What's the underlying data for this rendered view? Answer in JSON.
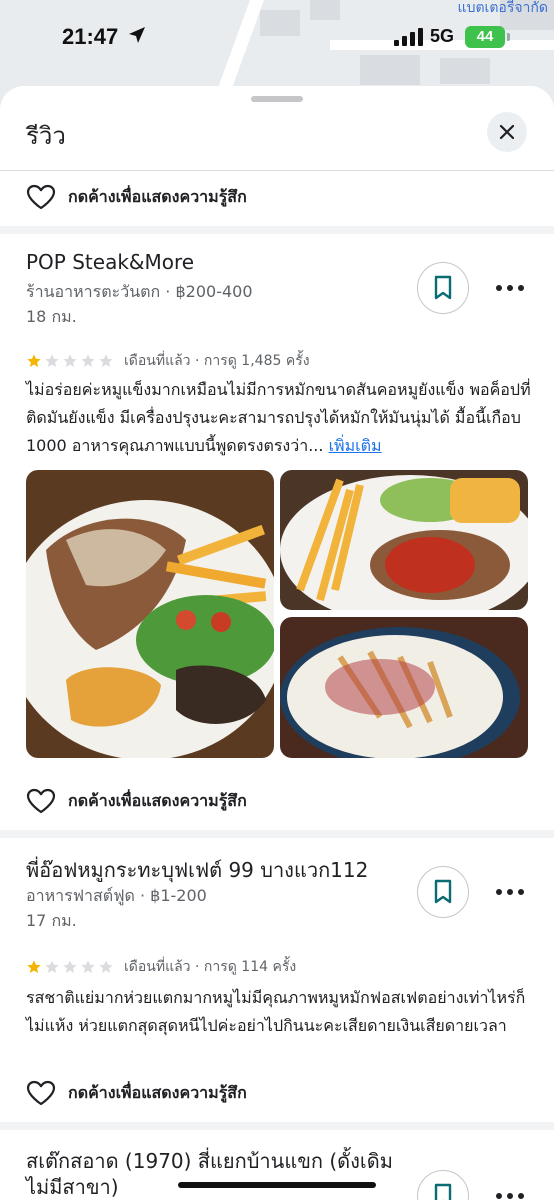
{
  "status_bar": {
    "time": "21:47",
    "network": "5G",
    "battery": "44"
  },
  "map": {
    "label": "แบตเตอรี่จากัด"
  },
  "sheet": {
    "title": "รีวิว",
    "close_icon": "close-icon"
  },
  "react_label": "กดค้างเพื่อแสดงความรู้สึก",
  "reviews": [
    {
      "place": "POP Steak&More",
      "category_price": "ร้านอาหารตะวันตก · ฿200-400",
      "distance": "18 กม.",
      "stars": 1,
      "meta": "เดือนที่แล้ว · การดู 1,485 ครั้ง",
      "text": "ไม่อร่อยค่ะหมูแข็งมากเหมือนไม่มีการหมักขนาดสันคอหมูยังแข็ง พอค็อปที่ติดมันยังแข็ง มีเครื่องปรุงนะคะสามารถปรุงได้หมักให้มันนุ่มได้ มื้อนี้เกือบ 1000 อาหารคุณภาพแบบนี้พูดตรงตรงว่า...",
      "more": "เพิ่มเติม"
    },
    {
      "place": "พี่อ๊อฟหมูกระทะบุฟเฟต์ 99 บางแวก112",
      "category_price": "อาหารฟาสต์ฟูด · ฿1-200",
      "distance": "17 กม.",
      "stars": 1,
      "meta": "เดือนที่แล้ว · การดู 114 ครั้ง",
      "text": "รสชาติแย่มากห่วยแตกมากหมูไม่มีคุณภาพหมูหมักฟอสเฟตอย่างเท่าไหร่ก็ไม่แห้ง ห่วยแตกสุดสุดหนีไปค่ะอย่าไปกินนะคะเสียดายเงินเสียดายเวลา"
    },
    {
      "place": "สเต๊กสอาด (1970) สี่แยกบ้านแขก (ดั้งเดิม ไม่มีสาขา)"
    }
  ],
  "colors": {
    "star_filled": "#f4b400",
    "star_empty": "#dadce0",
    "save_icon": "#0b6b73",
    "link": "#1a73e8"
  }
}
